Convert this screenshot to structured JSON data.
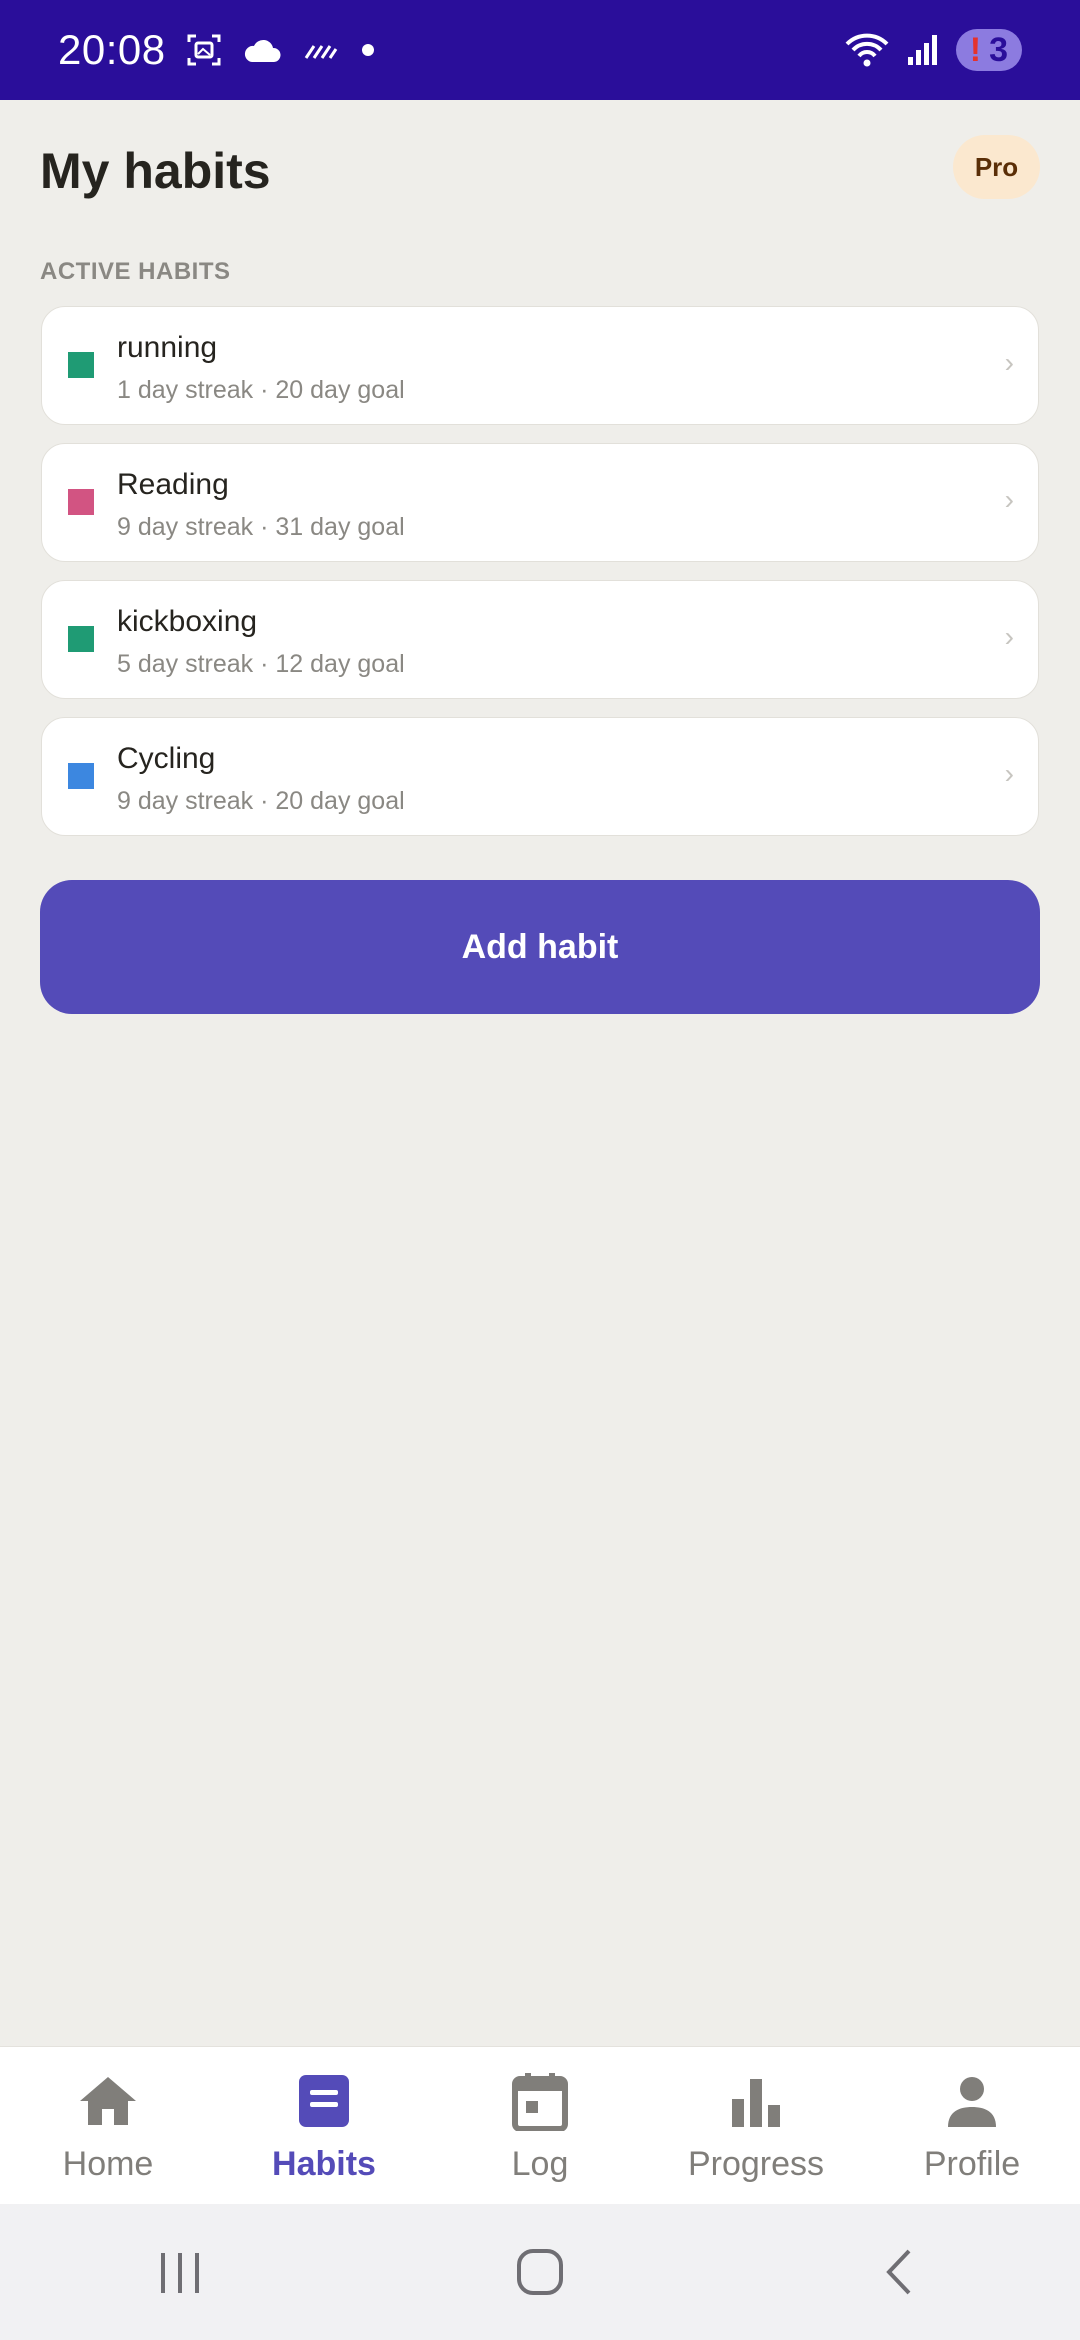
{
  "status_bar": {
    "time": "20:08",
    "notification_count": "3",
    "notification_alert": "!",
    "icons": [
      "screenshot-icon",
      "cloud-icon",
      "weather-icon",
      "dot-icon",
      "wifi-icon",
      "signal-icon"
    ]
  },
  "header": {
    "title": "My habits",
    "pro_badge": "Pro"
  },
  "section": {
    "label": "ACTIVE HABITS"
  },
  "habits": [
    {
      "name": "running",
      "meta": "1 day streak · 20 day goal",
      "color": "#1f9b74"
    },
    {
      "name": "Reading",
      "meta": "9 day streak · 31 day goal",
      "color": "#d25482"
    },
    {
      "name": "kickboxing",
      "meta": "5 day streak · 12 day goal",
      "color": "#1f9b74"
    },
    {
      "name": "Cycling",
      "meta": "9 day streak · 20 day goal",
      "color": "#3c87e0"
    }
  ],
  "add_button": {
    "label": "Add habit"
  },
  "bottom_nav": {
    "items": [
      {
        "label": "Home",
        "icon": "home-icon"
      },
      {
        "label": "Habits",
        "icon": "habits-icon",
        "active": true
      },
      {
        "label": "Log",
        "icon": "calendar-icon"
      },
      {
        "label": "Progress",
        "icon": "bar-chart-icon"
      },
      {
        "label": "Profile",
        "icon": "person-icon"
      }
    ]
  },
  "colors": {
    "status_bar": "#2a0e9a",
    "accent": "#544bb8",
    "background": "#efeeea",
    "pro_badge_bg": "#fbe8cf"
  }
}
